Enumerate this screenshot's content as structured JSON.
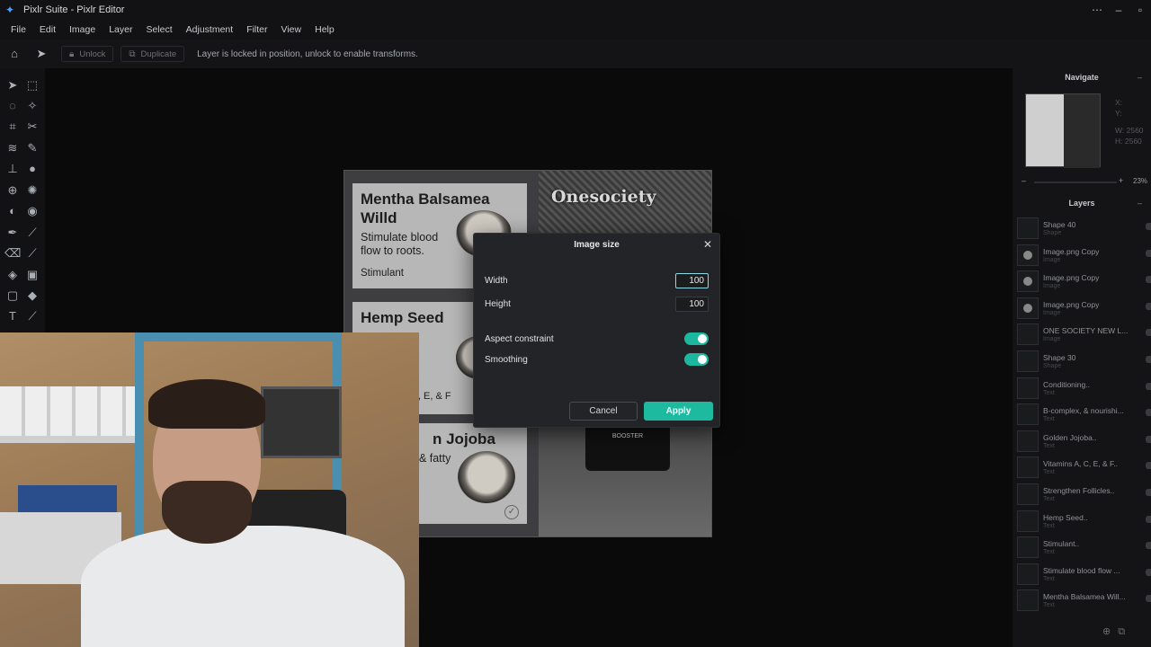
{
  "window": {
    "title": "Pixlr Suite - Pixlr Editor"
  },
  "menu": [
    "File",
    "Edit",
    "Image",
    "Layer",
    "Select",
    "Adjustment",
    "Filter",
    "View",
    "Help"
  ],
  "toolbar": {
    "unlock_label": "Unlock",
    "duplicate_label": "Duplicate",
    "message": "Layer is locked in position, unlock to enable transforms."
  },
  "canvas": {
    "brand": "Onesociety",
    "cards": [
      {
        "title": "Mentha Balsamea Willd",
        "text": "Stimulate blood flow to roots.",
        "tag": "Stimulant"
      },
      {
        "title": "Hemp Seed",
        "text": "",
        "tag": "C, E, & F"
      },
      {
        "title": "n Jojoba",
        "text": ", & fatty",
        "tag": ""
      }
    ],
    "bottle_label": "BOOSTER"
  },
  "dialog": {
    "title": "Image size",
    "width_label": "Width",
    "width_value": "100",
    "height_label": "Height",
    "height_value": "100",
    "aspect_label": "Aspect constraint",
    "aspect_on": true,
    "smoothing_label": "Smoothing",
    "smoothing_on": true,
    "cancel_label": "Cancel",
    "apply_label": "Apply"
  },
  "navigate": {
    "title": "Navigate",
    "x_label": "X:",
    "y_label": "Y:",
    "w_label": "W:",
    "w_value": "2560",
    "h_label": "H:",
    "h_value": "2560",
    "zoom": "23%"
  },
  "layers": {
    "title": "Layers",
    "items": [
      {
        "name": "Shape 40",
        "type": "Shape",
        "thumb": "blank"
      },
      {
        "name": "Image.png Copy",
        "type": "Image",
        "thumb": "img"
      },
      {
        "name": "Image.png Copy",
        "type": "Image",
        "thumb": "img"
      },
      {
        "name": "Image.png Copy",
        "type": "Image",
        "thumb": "img"
      },
      {
        "name": "ONE SOCIETY NEW L...",
        "type": "Image",
        "thumb": "blank"
      },
      {
        "name": "Shape 30",
        "type": "Shape",
        "thumb": "blank"
      },
      {
        "name": "Conditioning..",
        "type": "Text",
        "thumb": "blank"
      },
      {
        "name": "B-complex, & nourishi...",
        "type": "Text",
        "thumb": "blank"
      },
      {
        "name": "Golden Jojoba..",
        "type": "Text",
        "thumb": "blank"
      },
      {
        "name": "Vitamins A, C, E, & F..",
        "type": "Text",
        "thumb": "blank"
      },
      {
        "name": "Strengthen Follicles..",
        "type": "Text",
        "thumb": "blank"
      },
      {
        "name": "Hemp Seed..",
        "type": "Text",
        "thumb": "blank"
      },
      {
        "name": "Stimulant..",
        "type": "Text",
        "thumb": "blank"
      },
      {
        "name": "Stimulate blood flow ...",
        "type": "Text",
        "thumb": "blank"
      },
      {
        "name": "Mentha Balsamea Will...",
        "type": "Text",
        "thumb": "blank"
      }
    ]
  },
  "colors": {
    "accent": "#1dbaa0",
    "panel": "#141416",
    "dialog": "#232427"
  }
}
